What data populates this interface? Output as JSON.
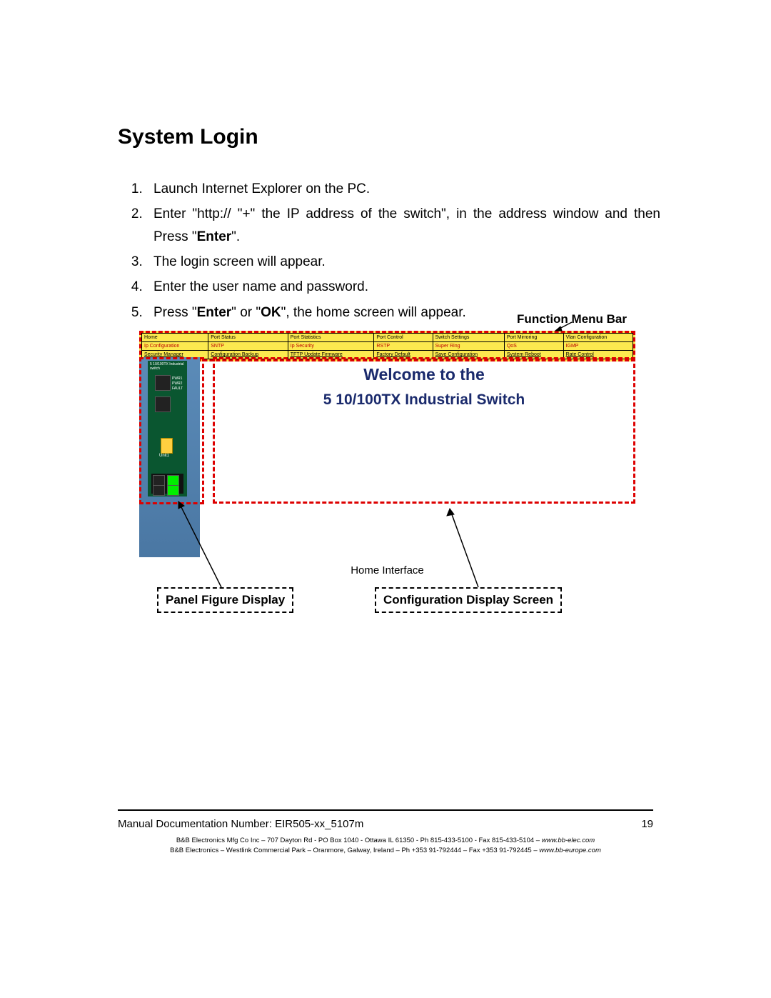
{
  "heading": "System Login",
  "steps": {
    "s1": "Launch Internet Explorer on the PC.",
    "s2a": "Enter \"http:// \"+\" the IP address of the switch\", in the address window and then Press \"",
    "s2b": "Enter",
    "s2c": "\".",
    "s3": "The login screen will appear.",
    "s4": "Enter the user name and password.",
    "s5a": "Press \"",
    "s5b": "Enter",
    "s5c": "\" or \"",
    "s5d": "OK",
    "s5e": "\", the home screen will appear."
  },
  "figure": {
    "label_fmb": "Function Menu Bar",
    "label_panel": "Panel Figure Display",
    "label_config": "Configuration Display Screen",
    "caption": "Home Interface",
    "menu": {
      "r1": [
        "Home",
        "Port Status",
        "Port Statistics",
        "Port Control",
        "Switch Settings",
        "Port Mirroring",
        "Vlan Configuration"
      ],
      "r2": [
        "Ip Configuration",
        "SNTP",
        "Ip Security",
        "RSTP",
        "Super Ring",
        "QoS",
        "IGMP"
      ],
      "r3": [
        "Security Manager",
        "Configuration Backup",
        "TFTP Update Firmware",
        "Factory Default",
        "Save Configuration",
        "System Reboot",
        "Rate Control"
      ]
    },
    "device_title": "5 10/100TX Industrial switch",
    "device_labels": {
      "pwr1": "PWR1",
      "pwr2": "PWR2",
      "fault": "FAULT",
      "unit": "Unit1"
    },
    "welcome_line1": "Welcome to the",
    "welcome_line2": "5 10/100TX Industrial Switch"
  },
  "footer": {
    "docnum": "Manual Documentation Number: EIR505-xx_5107m",
    "page": "19",
    "addr1a": "B&B Electronics Mfg Co Inc – 707 Dayton Rd - PO Box 1040 - Ottawa IL 61350 - Ph 815-433-5100 - Fax 815-433-5104 – ",
    "addr1b": "www.bb-elec.com",
    "addr2a": "B&B Electronics – Westlink Commercial Park – Oranmore, Galway, Ireland – Ph +353 91-792444 – Fax +353 91-792445 – ",
    "addr2b": "www.bb-europe.com"
  }
}
